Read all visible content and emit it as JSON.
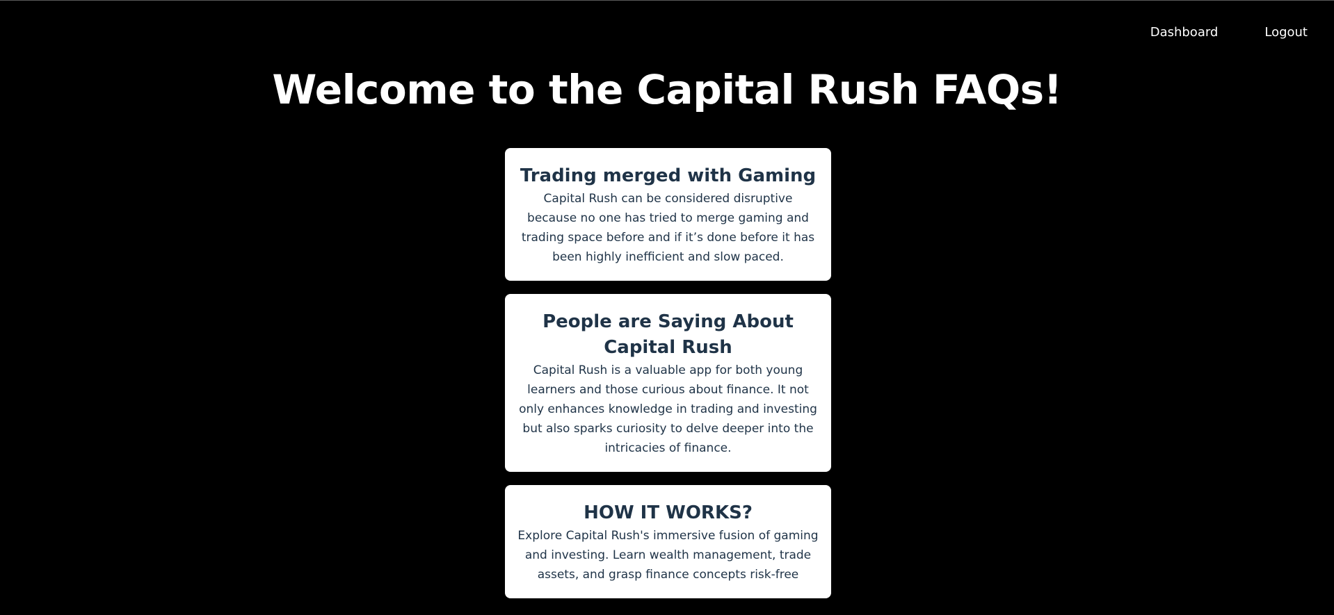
{
  "nav": {
    "dashboard_label": "Dashboard",
    "logout_label": "Logout"
  },
  "page": {
    "title": "Welcome to the Capital Rush FAQs!"
  },
  "faqs": [
    {
      "heading": "Trading merged with Gaming",
      "body": "Capital Rush can be considered disruptive because no one has tried to merge gaming and trading space before and if it’s done before it has been highly inefficient and slow paced."
    },
    {
      "heading": "People are Saying About Capital Rush",
      "body": "Capital Rush is a valuable app for both young learners and those curious about finance. It not only enhances knowledge in trading and investing but also sparks curiosity to delve deeper into the intricacies of finance."
    },
    {
      "heading": "HOW IT WORKS?",
      "body": "Explore Capital Rush's immersive fusion of gaming and investing. Learn wealth management, trade assets, and grasp finance concepts risk-free"
    }
  ],
  "colors": {
    "background": "#000000",
    "card": "#ffffff",
    "card_text": "#1f3347",
    "nav_text": "#ffffff"
  }
}
